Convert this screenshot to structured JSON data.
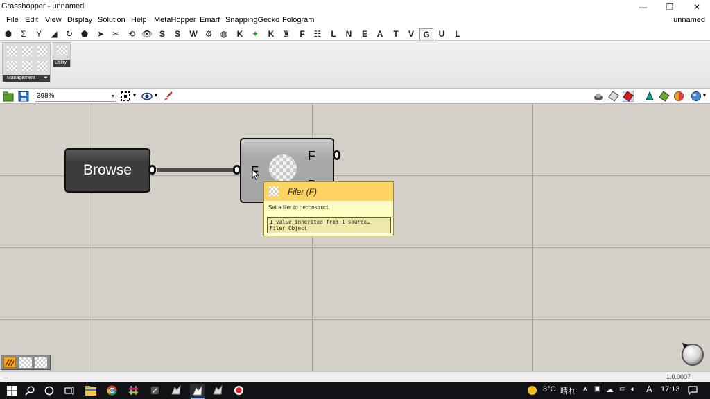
{
  "window": {
    "title": "Grasshopper - unnamed",
    "controls": {
      "minimize": "—",
      "restore": "❐",
      "close": "✕"
    }
  },
  "menu": {
    "items": [
      "File",
      "Edit",
      "View",
      "Display",
      "Solution",
      "Help",
      "MetaHopper",
      "Emarf",
      "SnappingGecko",
      "Fologram"
    ],
    "document_name": "unnamed"
  },
  "tabs": {
    "symbol_tabs": [
      "⬢",
      "Σ",
      "Y",
      "◢",
      "↻",
      "⬟",
      "➤",
      "✂",
      "👁"
    ],
    "letter_tabs": [
      "S",
      "S",
      "W",
      "K",
      "K",
      "F",
      "L",
      "N",
      "E",
      "A",
      "T",
      "V",
      "G",
      "U",
      "L"
    ],
    "active_tab": "G"
  },
  "ribbon": {
    "groups": [
      {
        "label": "Management"
      },
      {
        "label": "Utility"
      }
    ]
  },
  "canvas_toolbar": {
    "zoom_value": "398%",
    "zoom_chevron": "▾"
  },
  "canvas": {
    "browse_component": {
      "label": "Browse"
    },
    "filer_component": {
      "input_label": "F",
      "output_labels": [
        "F",
        "D"
      ]
    },
    "tooltip": {
      "title": "Filer (F)",
      "description": "Set a filer to deconstruct.",
      "info_lines": [
        "1 value inherited from 1 source…",
        "Filer Object"
      ]
    }
  },
  "statusbar": {
    "left_text": "...",
    "version": "1.0.0007"
  },
  "taskbar": {
    "start_icon": "windows-start-icon",
    "tray": {
      "temperature": "8°C",
      "weather": "晴れ",
      "ime": "A",
      "time": "17:13"
    }
  },
  "colors": {
    "canvas_bg": "#d4d0c8",
    "tooltip_head": "#ffd462",
    "tooltip_body": "#ffffc4",
    "taskbar": "#101216"
  }
}
